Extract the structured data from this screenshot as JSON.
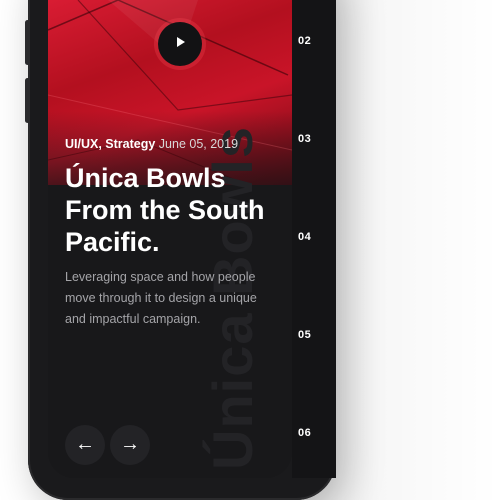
{
  "article": {
    "category": "UI/UX, Strategy",
    "date": "June 05, 2019",
    "title_line1": "Única Bowls",
    "title_line2": "From the South",
    "title_line3": "Pacific.",
    "description_line1": "Leveraging space and how people",
    "description_line2": "move through it to design a unique",
    "description_line3": "and impactful campaign.",
    "watermark": "Única Bowls"
  },
  "pager": [
    "02",
    "03",
    "04",
    "05",
    "06"
  ],
  "nav": {
    "prev_icon": "arrow-left-icon",
    "next_icon": "arrow-right-icon",
    "prev_glyph": "←",
    "next_glyph": "→"
  },
  "colors": {
    "hero_red": "#d91c33",
    "background": "#18181a",
    "accent_text": "#ffffff"
  }
}
